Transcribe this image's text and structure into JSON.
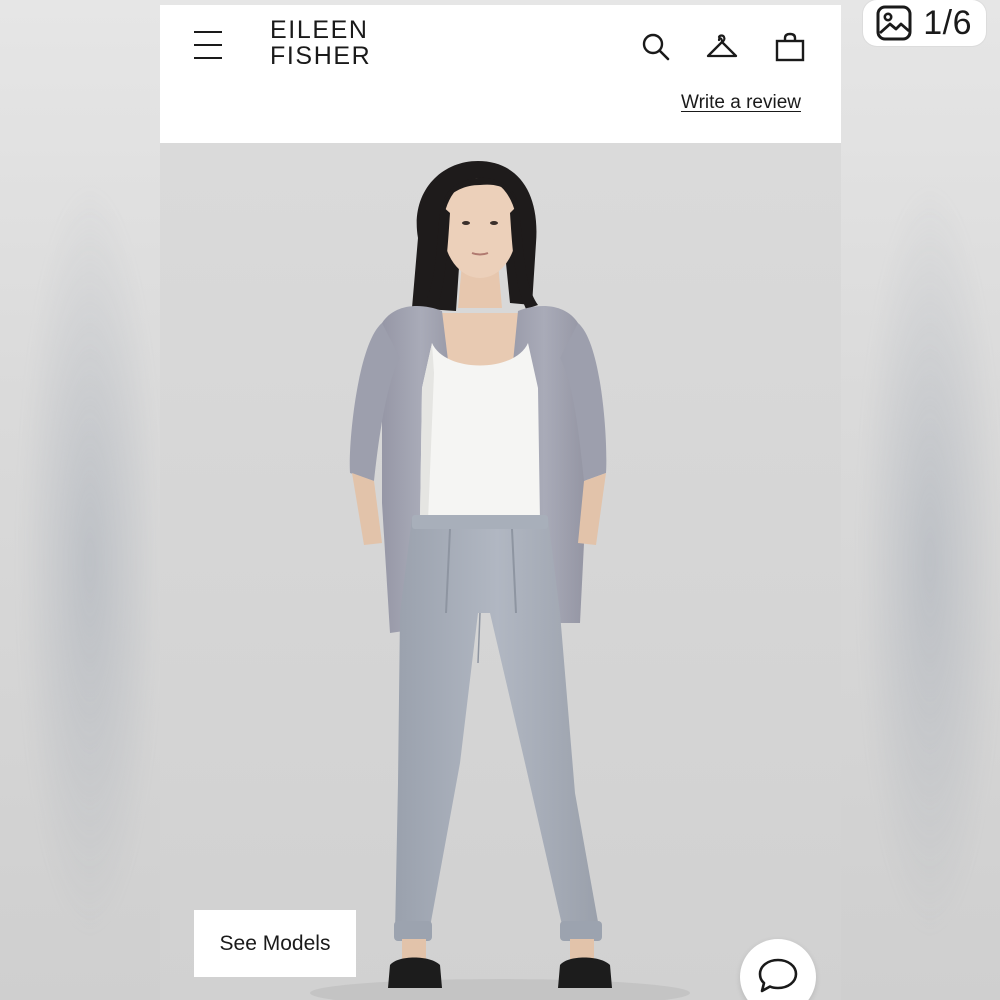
{
  "viewer": {
    "counter_text": "1/6",
    "counter_icon": "image-gallery-icon"
  },
  "header": {
    "brand_line1": "EILEEN",
    "brand_line2": "FISHER",
    "menu_icon": "hamburger-menu-icon",
    "search_icon": "search-icon",
    "wishlist_icon": "hanger-icon",
    "bag_icon": "shopping-bag-icon",
    "write_review_label": "Write a review"
  },
  "product_image": {
    "description_color_cardigan": "#9fa2b0",
    "description_color_pants": "#a7adb8",
    "description_color_tank": "#f4f4f2"
  },
  "actions": {
    "see_models_label": "See Models",
    "chat_icon": "chat-bubble-icon"
  },
  "colors": {
    "background": "#d9d9d9",
    "header_bg": "#ffffff",
    "text": "#1a1a1a"
  }
}
